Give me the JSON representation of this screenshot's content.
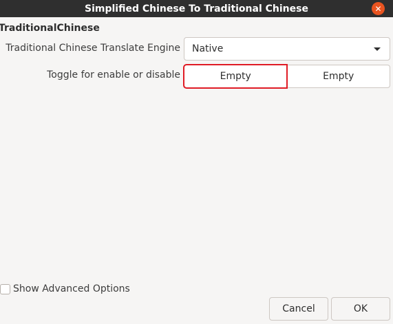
{
  "window": {
    "title": "Simplified Chinese To Traditional Chinese",
    "close_symbol": "✕"
  },
  "section": {
    "title": "TraditionalChinese"
  },
  "engine": {
    "label": "Traditional Chinese Translate Engine",
    "selected": "Native"
  },
  "toggle": {
    "label": "Toggle for enable or disable",
    "options": [
      "Empty",
      "Empty"
    ]
  },
  "advanced": {
    "label": "Show Advanced Options",
    "checked": false
  },
  "buttons": {
    "cancel": "Cancel",
    "ok": "OK"
  },
  "colors": {
    "titlebar": "#2f2f2f",
    "close": "#e95420",
    "focus": "#e01b24"
  }
}
